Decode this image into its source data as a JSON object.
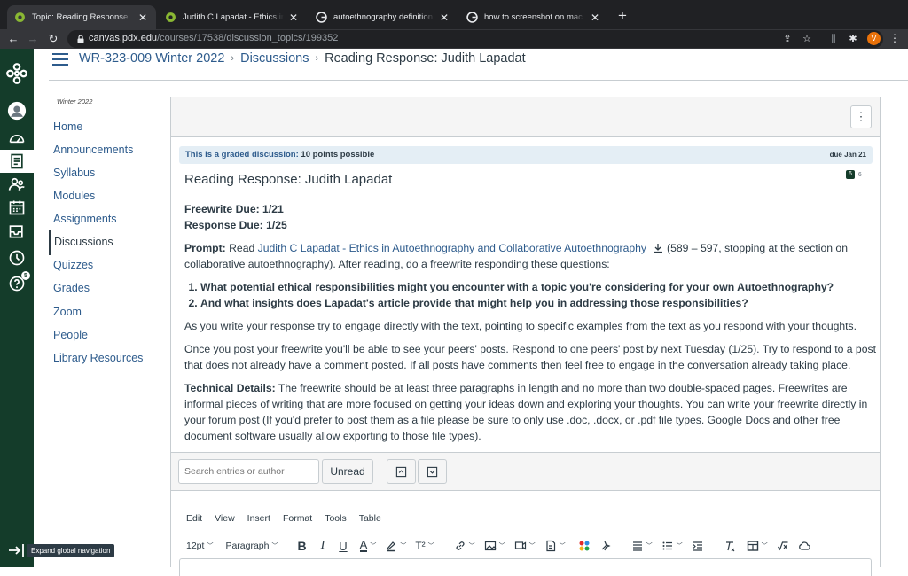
{
  "browser": {
    "tabs": [
      {
        "title": "Topic: Reading Response: Judith",
        "active": true
      },
      {
        "title": "Judith C Lapadat - Ethics in Au",
        "active": false
      },
      {
        "title": "autoethnography definition - G",
        "active": false
      },
      {
        "title": "how to screenshot on mac - Go",
        "active": false
      }
    ],
    "url_host": "canvas.pdx.edu",
    "url_path": "/courses/17538/discussion_topics/199352",
    "profile_initial": "V"
  },
  "global_nav": {
    "badge_count": "5",
    "expand_tooltip": "Expand global navigation"
  },
  "breadcrumb": {
    "course": "WR-323-009 Winter 2022",
    "section": "Discussions",
    "current": "Reading Response: Judith Lapadat"
  },
  "course_nav": {
    "term": "Winter 2022",
    "items": [
      {
        "label": "Home"
      },
      {
        "label": "Announcements"
      },
      {
        "label": "Syllabus"
      },
      {
        "label": "Modules"
      },
      {
        "label": "Assignments"
      },
      {
        "label": "Discussions"
      },
      {
        "label": "Quizzes"
      },
      {
        "label": "Grades"
      },
      {
        "label": "Zoom"
      },
      {
        "label": "People"
      },
      {
        "label": "Library Resources"
      }
    ]
  },
  "discussion": {
    "graded_label": "This is a graded discussion:",
    "points": "10 points possible",
    "due": "due Jan 21",
    "title": "Reading Response: Judith Lapadat",
    "unread_count": "6",
    "total_count": "6",
    "freewrite_due": "Freewrite Due: 1/21",
    "response_due": "Response Due: 1/25",
    "prompt_label": "Prompt:",
    "prompt_read": "Read",
    "prompt_link": "Judith C Lapadat - Ethics in Autoethnography and Collaborative Autoethnography",
    "prompt_rest": "(589 – 597, stopping at the section on collaborative autoethnography). After reading, do a freewrite responding these questions:",
    "questions": [
      "What potential ethical responsibilities might you encounter with a topic you're considering for your own Autoethnography?",
      "And what insights does Lapadat's article provide that might help you in addressing those responsibilities?"
    ],
    "para1": "As you write your response try to engage directly with the text, pointing to specific examples from the text as you respond with your thoughts.",
    "para2": "Once you post your freewrite you'll be able to see your peers' posts. Respond to one peers' post by next Tuesday (1/25). Try to respond to a post that does not already have a comment posted. If all posts have comments then feel free to engage in the conversation already taking place.",
    "tech_label": "Technical Details:",
    "tech_text": "The freewrite should be at least three paragraphs in length and no more than two double-spaced pages. Freewrites are informal pieces of writing that are more focused on getting your ideas down and exploring your thoughts. You can write your freewrite directly in your forum post (If you'd prefer to post them as a file please be sure to only use .doc, .docx, or .pdf file types. Google Docs and other free document software usually allow exporting to those file types)."
  },
  "search": {
    "placeholder": "Search entries or author",
    "unread_label": "Unread"
  },
  "editor": {
    "menu": [
      "Edit",
      "View",
      "Insert",
      "Format",
      "Tools",
      "Table"
    ],
    "font_size": "12pt",
    "block_format": "Paragraph"
  }
}
